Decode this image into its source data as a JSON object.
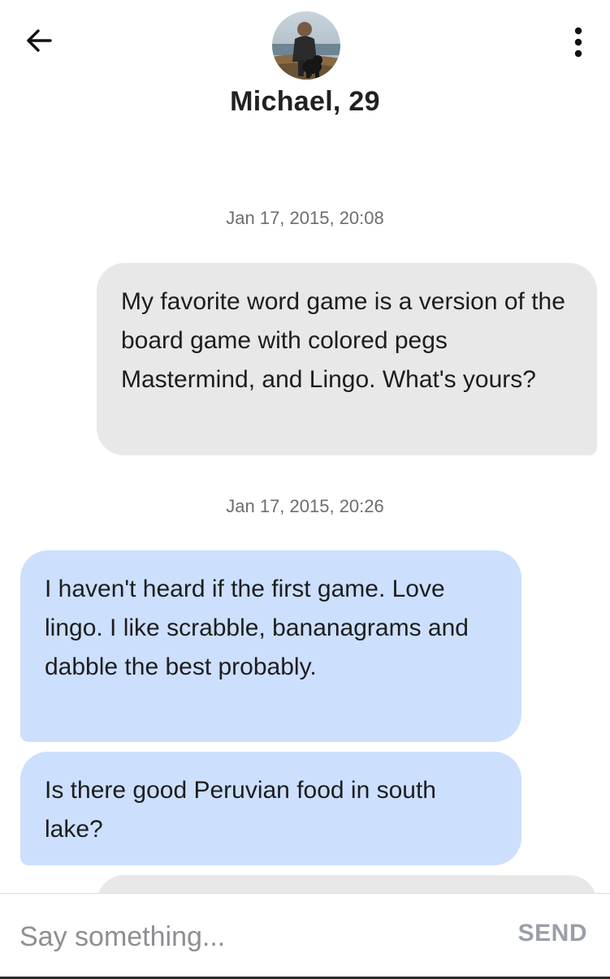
{
  "header": {
    "back_icon": "arrow-left-icon",
    "menu_icon": "more-vertical-icon",
    "contact_name": "Michael, 29"
  },
  "conversation": {
    "messages": [
      {
        "timestamp": "Jan 17, 2015, 20:08",
        "direction": "sent",
        "text": "My favorite word game is a version of the board game with colored pegs Mastermind, and Lingo. What's yours?"
      },
      {
        "timestamp": "Jan 17, 2015, 20:26",
        "direction": "received",
        "text": "I haven't heard if the first game. Love lingo. I like scrabble, bananagrams and dabble the best probably."
      },
      {
        "direction": "received",
        "text": "Is there good Peruvian food in south lake?"
      }
    ]
  },
  "composer": {
    "placeholder": "Say something...",
    "value": "",
    "send_label": "SEND"
  },
  "colors": {
    "sent_bubble": "#e8e8e8",
    "received_bubble": "#cce0fd",
    "send_inactive": "#9a9fa8"
  }
}
